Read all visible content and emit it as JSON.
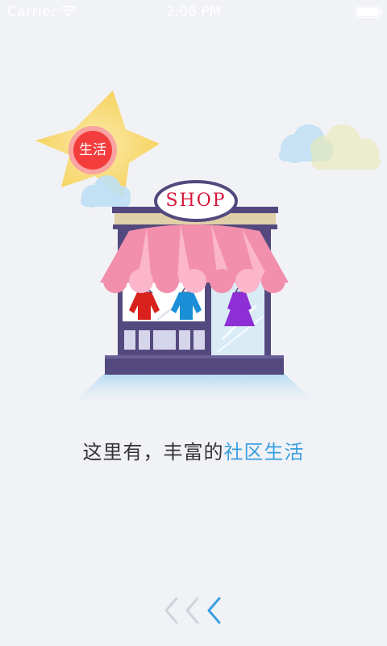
{
  "status_bar": {
    "carrier": "Carrier",
    "time": "2:06 PM",
    "wifi_icon": "wifi-icon",
    "battery_icon": "battery-icon"
  },
  "illustration": {
    "sun_label": "生活",
    "shop_sign": "SHOP"
  },
  "tagline": {
    "prefix": "这里有，丰富的",
    "highlight": "社区生活"
  },
  "page_indicator": {
    "icons": [
      "chevron-left-icon",
      "chevron-left-icon",
      "chevron-left-icon"
    ],
    "active_index": 2
  },
  "colors": {
    "background": "#f1f2f6",
    "highlight": "#3a9fe0",
    "shop_sign": "#d6183c",
    "awning_pink": "#f28fad",
    "shop_body": "#54497e",
    "sun": "#f9dc6a",
    "sun_badge": "#f33d3d"
  }
}
